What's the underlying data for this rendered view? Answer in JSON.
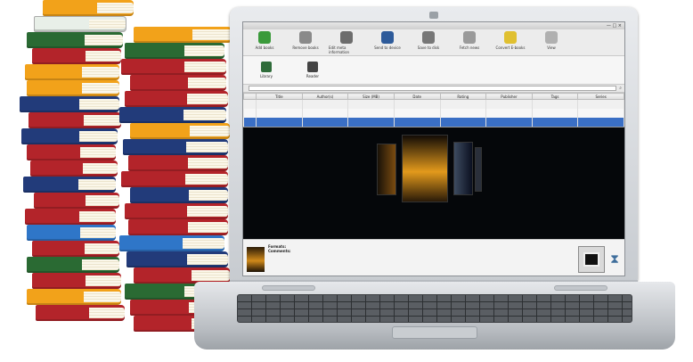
{
  "window": {
    "title": "",
    "controls": "— □ ×"
  },
  "toolbar": {
    "buttons": [
      {
        "label": "Add books",
        "icon": "add-books-icon",
        "color": "#3a9a3a"
      },
      {
        "label": "Remove books",
        "icon": "remove-books-icon",
        "color": "#8a8a8a"
      },
      {
        "label": "Edit meta information",
        "icon": "edit-meta-icon",
        "color": "#6d6d6d"
      },
      {
        "label": "Send to device",
        "icon": "device-icon",
        "color": "#2e5b9a"
      },
      {
        "label": "Save to disk",
        "icon": "save-icon",
        "color": "#777777"
      },
      {
        "label": "Fetch news",
        "icon": "news-icon",
        "color": "#9a9a9a"
      },
      {
        "label": "Convert E-books",
        "icon": "convert-icon",
        "color": "#e0c030"
      },
      {
        "label": "View",
        "icon": "view-icon",
        "color": "#b0b0b0"
      }
    ]
  },
  "library_panel": {
    "items": [
      {
        "label": "Library",
        "icon": "library-icon",
        "color": "#2f6c3a"
      },
      {
        "label": "Reader",
        "icon": "reader-icon",
        "color": "#444444"
      }
    ],
    "info_link": "",
    "info_text": ""
  },
  "search": {
    "label": "",
    "placeholder": ""
  },
  "table": {
    "columns": [
      "",
      "Title",
      "Author(s)",
      "Size (MB)",
      "Date",
      "Rating",
      "Publisher",
      "Tags",
      "Series"
    ],
    "rows": [
      {
        "num": "",
        "cells": [
          "",
          "",
          "",
          "",
          "",
          "",
          "",
          ""
        ],
        "selected": false
      },
      {
        "num": "",
        "cells": [
          "",
          "",
          "",
          "",
          "",
          "",
          "",
          ""
        ],
        "selected": false
      },
      {
        "num": "",
        "cells": [
          "",
          "",
          "",
          "",
          "",
          "",
          "",
          ""
        ],
        "selected": true
      }
    ]
  },
  "cover_flow": {
    "featured_title": ""
  },
  "details": {
    "formats_label": "Formats:",
    "formats_value": "",
    "comments_label": "Comments:",
    "comments_text": ""
  },
  "colors": {
    "selection": "#3a6fc5",
    "cover_bg": "#05070a"
  }
}
